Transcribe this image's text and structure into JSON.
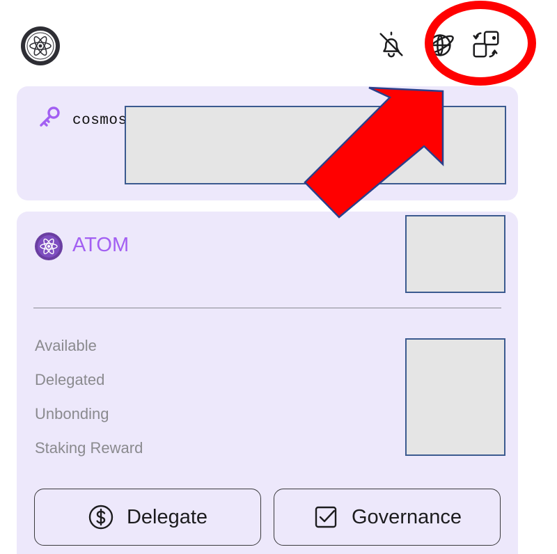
{
  "header": {
    "logo_icon": "cosmos-logo-icon",
    "icons": [
      "bell-slash-icon",
      "globe-icon",
      "wallet-switch-icon"
    ]
  },
  "address": {
    "icon": "key-icon",
    "text": "cosmos"
  },
  "asset": {
    "icon": "atom-coin-icon",
    "symbol": "ATOM",
    "balance_labels": {
      "available": "Available",
      "delegated": "Delegated",
      "unbonding": "Unbonding",
      "staking_reward": "Staking Reward"
    }
  },
  "actions": {
    "delegate": {
      "label": "Delegate",
      "icon": "dollar-circle-icon"
    },
    "governance": {
      "label": "Governance",
      "icon": "checkbox-icon"
    }
  },
  "annotation": {
    "highlight_color": "#ff0000",
    "shapes": [
      "red-circle-highlight",
      "red-arrow-pointer"
    ]
  },
  "colors": {
    "accent": "#a25ff2",
    "card_background": "#ede8fb",
    "redaction_fill": "#e5e5e5",
    "redaction_border": "#3b5a8f"
  }
}
